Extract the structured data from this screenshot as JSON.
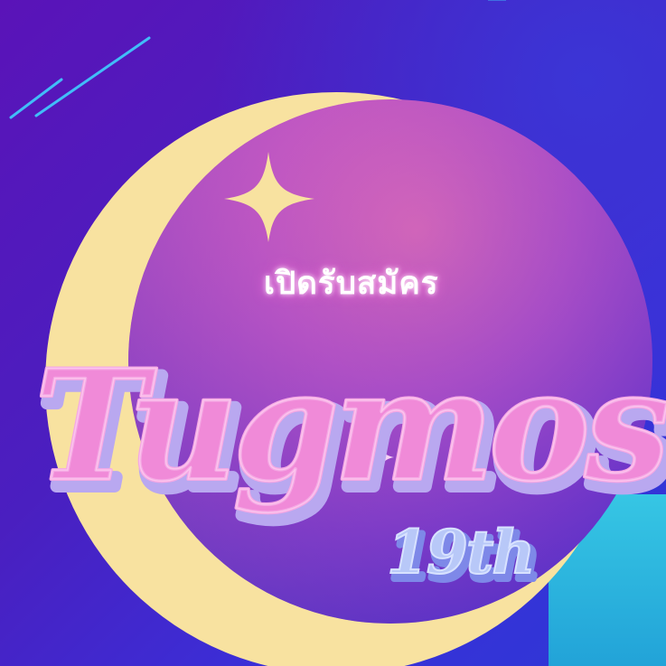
{
  "poster": {
    "subtitle": "เปิดรับสมัคร",
    "title": "Tugmos",
    "edition": "19th"
  },
  "colors": {
    "background": "#4a1fc0",
    "moon": "#f8e2a0",
    "disc_top": "#c05ac8",
    "disc_bottom": "#5a2cc8",
    "title_fill": "#f08ad8",
    "title_outline": "#b9a8f0",
    "edition_fill": "#b8c8f8",
    "star": "#f8e2a0",
    "accent_teal": "#36c6e4"
  },
  "icons": [
    "star-sparkle-icon",
    "small-star-icon",
    "crescent-moon-icon"
  ]
}
